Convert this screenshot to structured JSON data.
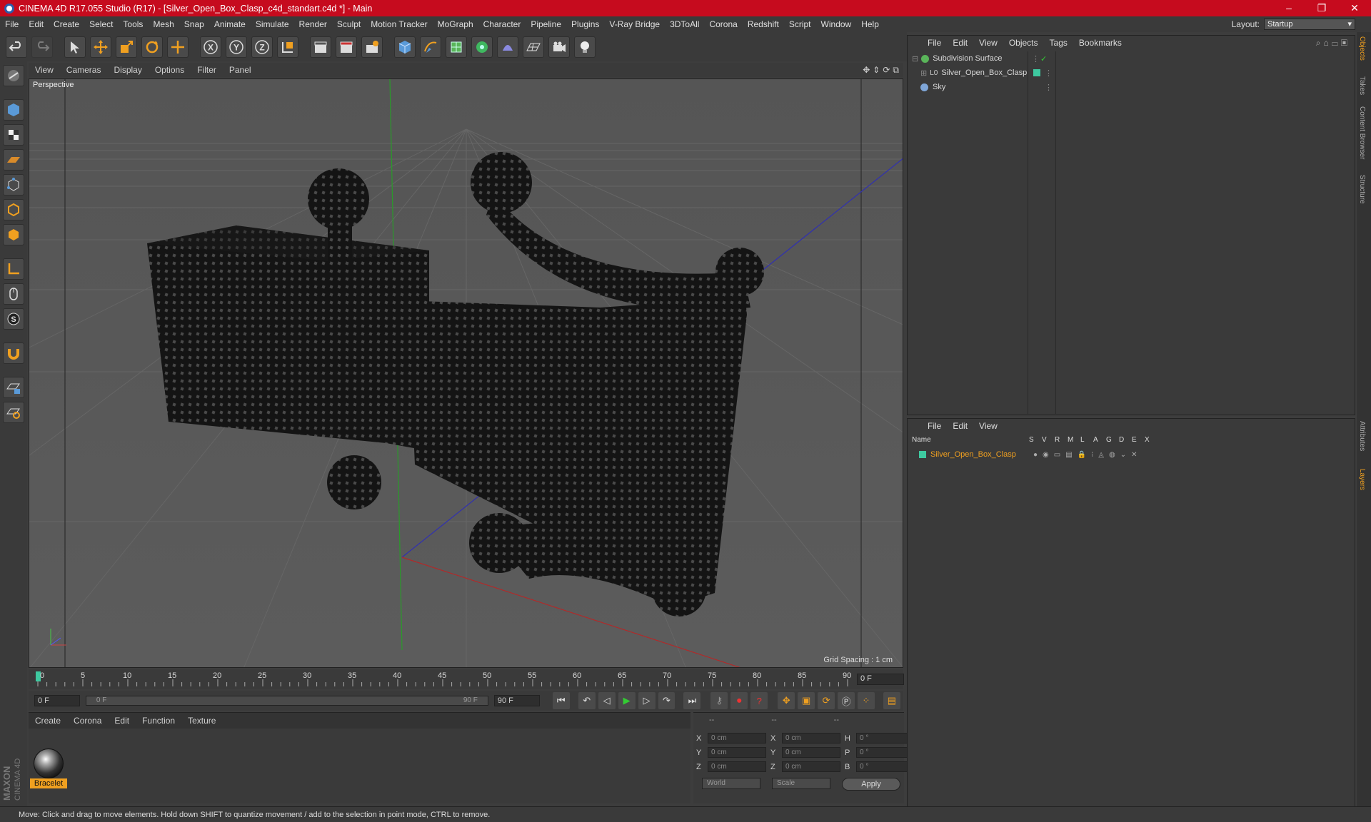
{
  "window": {
    "title": "CINEMA 4D R17.055 Studio (R17) - [Silver_Open_Box_Clasp_c4d_standart.c4d *] - Main",
    "min": "–",
    "max": "❐",
    "close": "✕"
  },
  "menu": [
    "File",
    "Edit",
    "Create",
    "Select",
    "Tools",
    "Mesh",
    "Snap",
    "Animate",
    "Simulate",
    "Render",
    "Sculpt",
    "Motion Tracker",
    "MoGraph",
    "Character",
    "Pipeline",
    "Plugins",
    "V-Ray Bridge",
    "3DToAll",
    "Corona",
    "Redshift",
    "Script",
    "Window",
    "Help"
  ],
  "layout": {
    "label": "Layout:",
    "value": "Startup"
  },
  "toolbar": {
    "axis_x": "X",
    "axis_y": "Y",
    "axis_z": "Z"
  },
  "viewport": {
    "menu": [
      "View",
      "Cameras",
      "Display",
      "Options",
      "Filter",
      "Panel"
    ],
    "label": "Perspective",
    "grid_spacing": "Grid Spacing : 1 cm"
  },
  "timeline": {
    "ticks": [
      "0",
      "5",
      "10",
      "15",
      "20",
      "25",
      "30",
      "35",
      "40",
      "45",
      "50",
      "55",
      "60",
      "65",
      "70",
      "75",
      "80",
      "85",
      "90"
    ],
    "current": "0 F"
  },
  "transport": {
    "start": "0 F",
    "range_start": "0 F",
    "range_end": "90 F",
    "end": "90 F"
  },
  "materials": {
    "menu": [
      "Create",
      "Corona",
      "Edit",
      "Function",
      "Texture"
    ],
    "items": [
      {
        "name": "Bracelet"
      }
    ]
  },
  "coords": {
    "headers": [
      "--",
      "--",
      "--"
    ],
    "rows": [
      {
        "l1": "X",
        "v1": "0 cm",
        "l2": "X",
        "v2": "0 cm",
        "l3": "H",
        "v3": "0 °"
      },
      {
        "l1": "Y",
        "v1": "0 cm",
        "l2": "Y",
        "v2": "0 cm",
        "l3": "P",
        "v3": "0 °"
      },
      {
        "l1": "Z",
        "v1": "0 cm",
        "l2": "Z",
        "v2": "0 cm",
        "l3": "B",
        "v3": "0 °"
      }
    ],
    "world": "World",
    "scale": "Scale",
    "apply": "Apply"
  },
  "objects": {
    "menu": [
      "File",
      "Edit",
      "View",
      "Objects",
      "Tags",
      "Bookmarks"
    ],
    "items": [
      {
        "name": "Subdivision Surface",
        "color": "#5ab55a"
      },
      {
        "name": "Silver_Open_Box_Clasp",
        "color": "#3ec9a0"
      },
      {
        "name": "Sky",
        "color": "#7fa6d8"
      }
    ]
  },
  "layers": {
    "menu": [
      "File",
      "Edit",
      "View"
    ],
    "columns": [
      "Name",
      "S",
      "V",
      "R",
      "M",
      "L",
      "A",
      "G",
      "D",
      "E",
      "X"
    ],
    "items": [
      {
        "name": "Silver_Open_Box_Clasp",
        "color": "#3ec9a0"
      }
    ]
  },
  "right_tabs": [
    "Objects",
    "Takes",
    "Content Browser",
    "Structure",
    "Attributes",
    "Layers"
  ],
  "brand": {
    "line1": "MAXON",
    "line2": "CINEMA 4D"
  },
  "status": "Move: Click and drag to move elements. Hold down SHIFT to quantize movement / add to the selection in point mode, CTRL to remove.",
  "colors": {
    "title_bar": "#c60b1e",
    "accent": "#f0a020",
    "selected_text": "#f0a020"
  }
}
